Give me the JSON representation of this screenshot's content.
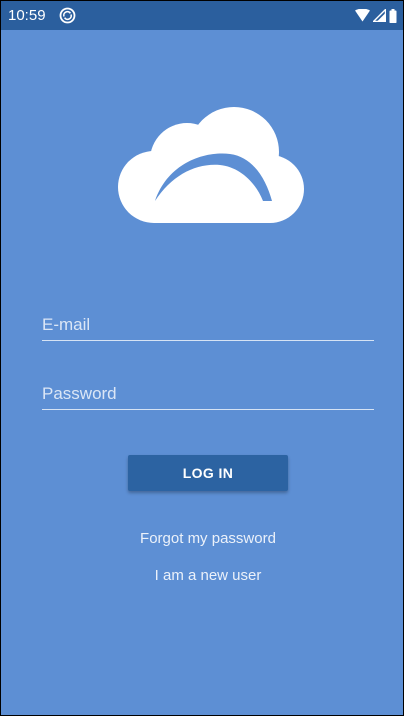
{
  "status_bar": {
    "time": "10:59",
    "icons": [
      "sync-icon",
      "wifi-icon",
      "signal-icon",
      "battery-icon"
    ]
  },
  "login_form": {
    "email_placeholder": "E-mail",
    "email_value": "",
    "password_placeholder": "Password",
    "password_value": "",
    "login_label": "LOG IN"
  },
  "links": {
    "forgot_password": "Forgot my password",
    "new_user": "I am a new user"
  },
  "colors": {
    "background": "#5d8fd4",
    "status_bar": "#2b5f9e",
    "button": "#2c63a2",
    "text": "#ffffff"
  }
}
